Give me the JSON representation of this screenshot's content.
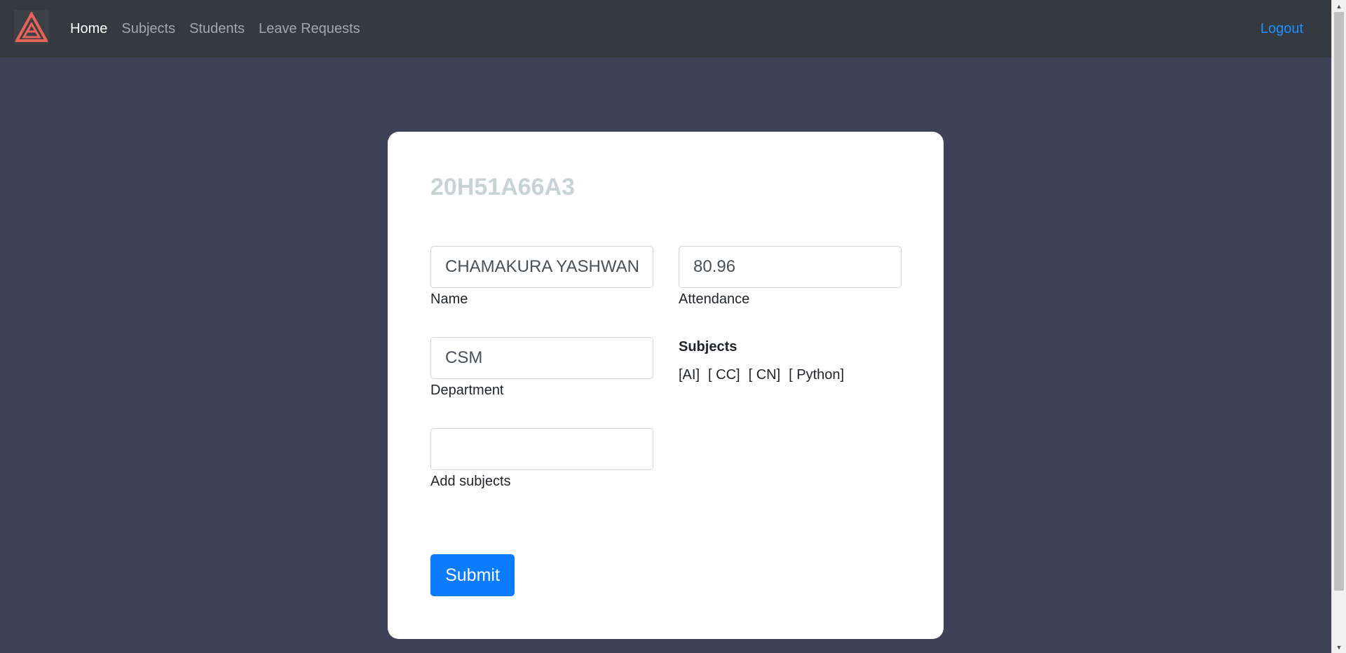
{
  "nav": {
    "links": [
      {
        "label": "Home"
      },
      {
        "label": "Subjects"
      },
      {
        "label": "Students"
      },
      {
        "label": "Leave Requests"
      }
    ],
    "logout_label": "Logout",
    "logo_icon": "triangle-logo-icon"
  },
  "form": {
    "student_id": "20H51A66A3",
    "name_value": "CHAMAKURA YASHWANTH",
    "name_label": "Name",
    "attendance_value": "80.96",
    "attendance_label": "Attendance",
    "department_value": "CSM",
    "department_label": "Department",
    "add_subjects_value": "",
    "add_subjects_label": "Add subjects",
    "subjects_title": "Subjects",
    "subjects": [
      "[AI]",
      "[ CC]",
      "[ CN]",
      "[ Python]"
    ],
    "submit_label": "Submit"
  },
  "colors": {
    "navbar_bg": "#343a40",
    "page_bg": "#3f4256",
    "accent": "#0b7cff",
    "logo": "#e8645a"
  }
}
